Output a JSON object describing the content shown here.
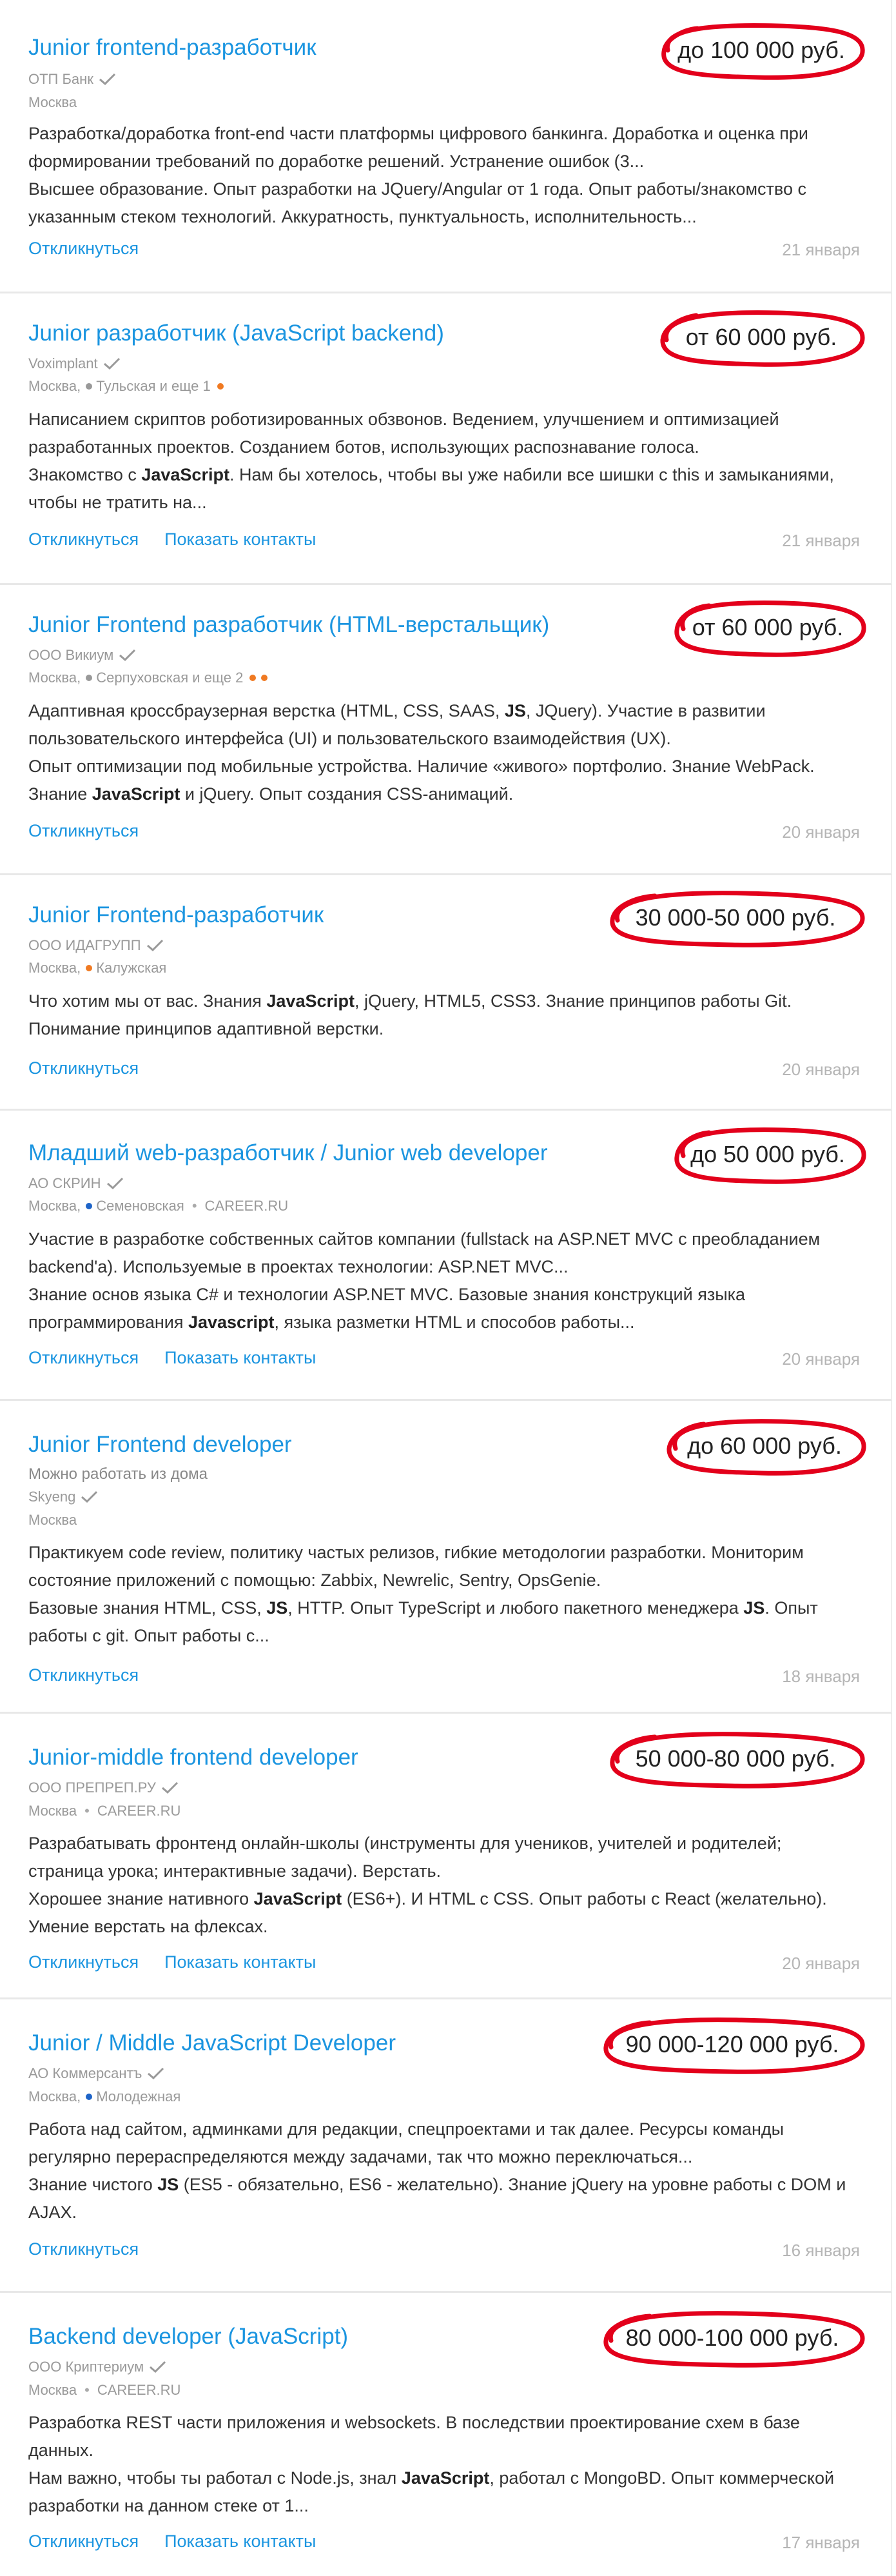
{
  "colors": {
    "link": "#1b95e0",
    "circle": "#e3001b",
    "metro_gray": "#999999",
    "metro_orange": "#f07a22",
    "metro_blue": "#1e64c8"
  },
  "vacancies": [
    {
      "title": "Junior frontend-разработчик",
      "salary": "до 100 000 руб.",
      "company": "ОТП Банк",
      "location": {
        "city": "Москва"
      },
      "description": [
        "Разработка/доработка front-end части платформы цифрового банкинга. Доработка и оценка при формировании требований по доработке решений. Устранение ошибок (3...",
        "Высшее образование. Опыт разработки на JQuery/Angular от 1 года. Опыт работы/знакомство с указанным стеком технологий. Аккуратность, пунктуальность, исполнительность..."
      ],
      "respond": "Откликнуться",
      "date": "21 января"
    },
    {
      "title": "Junior разработчик (JavaScript backend)",
      "salary": "от 60 000 руб.",
      "company": "Voximplant",
      "location": {
        "city": "Москва,",
        "metro": "Тульская и еще 1"
      },
      "description": [
        "Написанием скриптов роботизированных обзвонов. Ведением, улучшением и оптимизацией разработанных проектов. Созданием ботов, использующих распознавание голоса.",
        "Знакомство с JavaScript. Нам бы хотелось, чтобы вы уже набили все шишки с this и замыканиями, чтобы не тратить на..."
      ],
      "respond": "Откликнуться",
      "contacts": "Показать контакты",
      "date": "21 января"
    },
    {
      "title": "Junior Frontend разработчик (HTML-верстальщик)",
      "salary": "от 60 000 руб.",
      "company": "ООО Викиум",
      "location": {
        "city": "Москва,",
        "metro": "Серпуховская и еще 2"
      },
      "description": [
        "Адаптивная кроссбраузерная верстка (HTML, CSS, SAAS, JS, JQuery). Участие в развитии пользовательского интерфейса (UI) и пользовательского взаимодействия (UX).",
        "Опыт оптимизации под мобильные устройства. Наличие «живого» портфолио. Знание WebPack. Знание JavaScript и jQuery. Опыт создания CSS-анимаций."
      ],
      "respond": "Откликнуться",
      "date": "20 января"
    },
    {
      "title": "Junior Frontend-разработчик",
      "salary": "30 000-50 000 руб.",
      "company": "ООО ИДАГРУПП",
      "location": {
        "city": "Москва,",
        "metro": "Калужская"
      },
      "description": [
        "Что хотим мы от вас. Знания JavaScript, jQuery, HTML5, CSS3. Знание принципов работы Git. Понимание принципов адаптивной верстки."
      ],
      "respond": "Откликнуться",
      "date": "20 января"
    },
    {
      "title": "Младший web-разработчик / Junior web developer",
      "salary": "до 50 000 руб.",
      "company": "АО СКРИН",
      "location": {
        "city": "Москва,",
        "metro": "Семеновская",
        "source": "CAREER.RU"
      },
      "description": [
        "Участие в разработке собственных сайтов компании (fullstack на ASP.NET MVC с преобладанием backend'а). Используемые в проектах технологии: ASP.NET MVC...",
        "Знание основ языка C# и технологии ASP.NET MVC. Базовые знания конструкций языка программирования Javascript, языка разметки HTML и способов работы..."
      ],
      "respond": "Откликнуться",
      "contacts": "Показать контакты",
      "date": "20 января"
    },
    {
      "title": "Junior Frontend developer",
      "salary": "до 60 000 руб.",
      "remote": "Можно работать из дома",
      "company": "Skyeng",
      "location": {
        "city": "Москва"
      },
      "description": [
        "Практикуем code review, политику частых релизов, гибкие методологии разработки. Мониторим состояние приложений с помощью: Zabbix, Newrelic, Sentry, OpsGenie.",
        "Базовые знания HTML, CSS, JS, HTTP. Опыт TypeScript и любого пакетного менеджера JS. Опыт работы с git. Опыт работы с..."
      ],
      "respond": "Откликнуться",
      "date": "18 января"
    },
    {
      "title": "Junior-middle frontend developer",
      "salary": "50 000-80 000 руб.",
      "company": "ООО ПРЕПРЕП.РУ",
      "location": {
        "city": "Москва",
        "source": "CAREER.RU"
      },
      "description": [
        "Разрабатывать фронтенд онлайн-школы (инструменты для учеников, учителей и родителей; страница урока; интерактивные задачи). Верстать.",
        "Хорошее знание нативного JavaScript (ES6+). И HTML с CSS. Опыт работы с React (желательно). Умение верстать на флексах."
      ],
      "respond": "Откликнуться",
      "contacts": "Показать контакты",
      "date": "20 января"
    },
    {
      "title": "Junior / Middle JavaScript Developer",
      "salary": "90 000-120 000 руб.",
      "company": "АО Коммерсантъ",
      "location": {
        "city": "Москва,",
        "metro": "Молодежная"
      },
      "description": [
        "Работа над сайтом, админками для редакции, спецпроектами и так далее. Ресурсы команды регулярно перераспределяются между задачами, так что можно переключаться...",
        "Знание чистого JS (ES5 - обязательно, ES6 - желательно). Знание jQuery на уровне работы с DOM и AJAX."
      ],
      "respond": "Откликнуться",
      "date": "16 января"
    },
    {
      "title": "Backend developer (JavaScript)",
      "salary": "80 000-100 000 руб.",
      "company": "ООО Криптериум",
      "location": {
        "city": "Москва",
        "source": "CAREER.RU"
      },
      "description": [
        "Разработка REST части приложения и websockets. В последствии проектирование схем в базе данных.",
        "Нам важно, чтобы ты работал с Node.js, знал JavaScript, работал с MongoBD. Опыт коммерческой разработки на данном стеке от 1..."
      ],
      "respond": "Откликнуться",
      "contacts": "Показать контакты",
      "date": "17 января"
    }
  ]
}
